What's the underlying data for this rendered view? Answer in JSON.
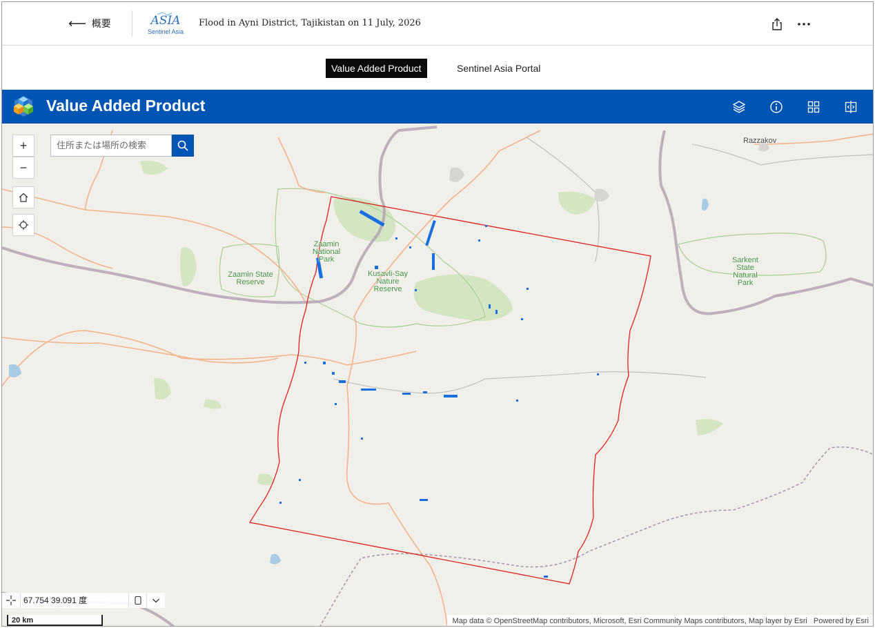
{
  "header": {
    "back_label": "概要",
    "story_title": "Flood in Ayni District, Tajikistan on 11 July, 2026",
    "logo_text": "Sentinel Asia"
  },
  "tabs": [
    {
      "label": "Value Added Product",
      "active": true
    },
    {
      "label": "Sentinel Asia Portal",
      "active": false
    }
  ],
  "app": {
    "title": "Value Added Product",
    "bar_color": "#0054b4",
    "icons": [
      "layers-icon",
      "info-icon",
      "basemap-gallery-icon",
      "swipe-compare-icon"
    ]
  },
  "map": {
    "search_placeholder": "住所または場所の検索",
    "controls": [
      "zoom-in-icon",
      "zoom-out-icon",
      "home-icon",
      "locate-icon"
    ],
    "labels": {
      "razzakov": "Razzakov",
      "zaamin_np": [
        "Zaamin",
        "National",
        "Park"
      ],
      "zaamin_sr": [
        "Zaamin State",
        "Reserve"
      ],
      "kusavli": [
        "Kusavli-Say",
        "Nature",
        "Reserve"
      ],
      "sarkent": [
        "Sarkent",
        "State",
        "Natural",
        "Park"
      ]
    },
    "coordinates": "67.754 39.091 度",
    "scale": "20 km",
    "attribution": "Map data © OpenStreetMap contributors, Microsoft, Esri Community Maps contributors, Map layer by Esri",
    "powered_by": "Powered by Esri",
    "aoi_color": "#e02020",
    "flood_color": "#1a6fe0"
  }
}
